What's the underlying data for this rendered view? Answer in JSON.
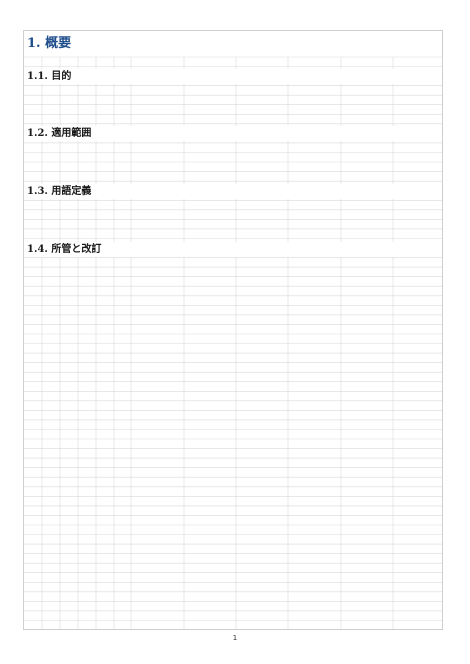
{
  "document": {
    "title": "1. 概要",
    "sections": [
      {
        "heading": "1.1. 目的"
      },
      {
        "heading": "1.2. 適用範囲"
      },
      {
        "heading": "1.3. 用語定義"
      },
      {
        "heading": "1.4. 所管と改訂"
      }
    ]
  },
  "footer": {
    "page_number": "1"
  },
  "colors": {
    "title": "#1f4e8c",
    "gridline": "#d9d9d9",
    "border": "#cfcfcf"
  }
}
